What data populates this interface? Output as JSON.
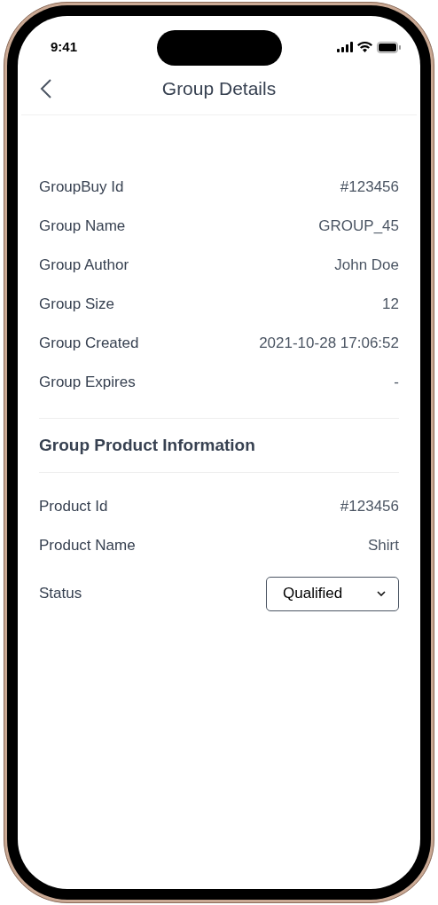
{
  "status_bar": {
    "time": "9:41"
  },
  "header": {
    "title": "Group Details"
  },
  "group_details": [
    {
      "label": "GroupBuy Id",
      "value": "#123456"
    },
    {
      "label": "Group Name",
      "value": "GROUP_45"
    },
    {
      "label": "Group Author",
      "value": "John Doe"
    },
    {
      "label": "Group Size",
      "value": "12"
    },
    {
      "label": "Group Created",
      "value": "2021-10-28 17:06:52"
    },
    {
      "label": "Group Expires",
      "value": "-"
    }
  ],
  "product_section": {
    "title": "Group Product Information",
    "rows": [
      {
        "label": "Product Id",
        "value": "#123456"
      },
      {
        "label": "Product Name",
        "value": "Shirt"
      }
    ],
    "status": {
      "label": "Status",
      "value": "Qualified"
    }
  }
}
